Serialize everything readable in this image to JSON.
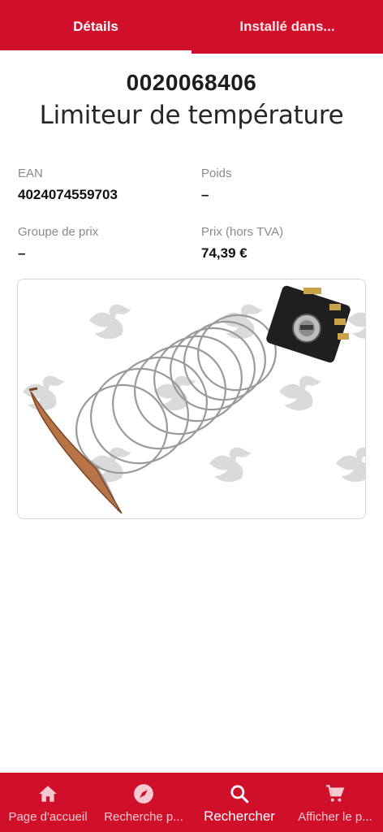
{
  "tabs": [
    {
      "label": "Détails"
    },
    {
      "label": "Installé dans..."
    }
  ],
  "product": {
    "part_number": "0020068406",
    "name": "Limiteur de température"
  },
  "attributes": [
    {
      "label": "EAN",
      "value": "4024074559703"
    },
    {
      "label": "Poids",
      "value": "–"
    },
    {
      "label": "Groupe de prix",
      "value": "–"
    },
    {
      "label": "Prix (hors TVA)",
      "value": "74,39 €"
    }
  ],
  "product_image": {
    "icon": "thermostat-capillary-image",
    "watermark": "bird-logo-watermark"
  },
  "bottom_nav": [
    {
      "label": "Page d'accueil",
      "icon": "home-icon"
    },
    {
      "label": "Recherche p...",
      "icon": "compass-icon"
    },
    {
      "label": "Rechercher",
      "icon": "search-icon",
      "active": true
    },
    {
      "label": "Afficher le p...",
      "icon": "cart-icon"
    }
  ],
  "colors": {
    "brand": "#d0102a",
    "text": "#1a1a1a",
    "muted": "#8a8a8a"
  }
}
